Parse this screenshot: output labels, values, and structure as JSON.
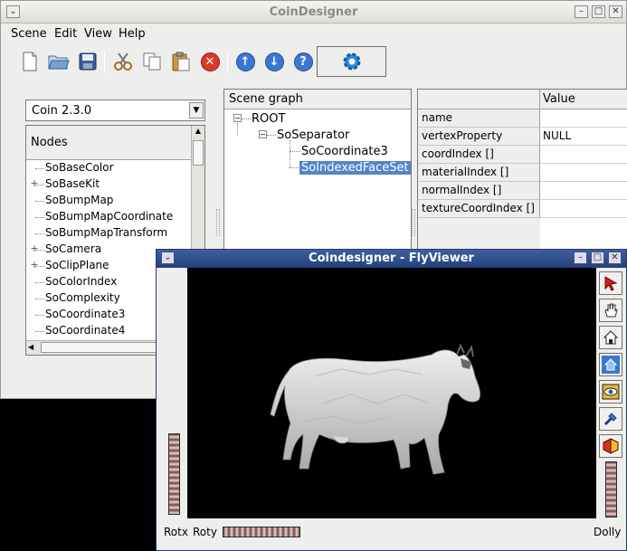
{
  "main_window": {
    "title": "CoinDesigner",
    "menu": [
      "Scene",
      "Edit",
      "View",
      "Help"
    ],
    "toolbar_icons": [
      "new-file-icon",
      "open-folder-icon",
      "save-icon",
      "cut-icon",
      "copy-icon",
      "paste-icon",
      "delete-icon",
      "up-arrow-icon",
      "down-arrow-icon",
      "help-icon",
      "gear-icon"
    ]
  },
  "node_library": {
    "combo_value": "Coin 2.3.0",
    "header": "Nodes",
    "items": [
      {
        "label": "SoBaseColor",
        "expandable": false
      },
      {
        "label": "SoBaseKit",
        "expandable": true
      },
      {
        "label": "SoBumpMap",
        "expandable": false
      },
      {
        "label": "SoBumpMapCoordinate",
        "expandable": false
      },
      {
        "label": "SoBumpMapTransform",
        "expandable": false
      },
      {
        "label": "SoCamera",
        "expandable": true
      },
      {
        "label": "SoClipPlane",
        "expandable": true
      },
      {
        "label": "SoColorIndex",
        "expandable": false
      },
      {
        "label": "SoComplexity",
        "expandable": false
      },
      {
        "label": "SoCoordinate3",
        "expandable": false
      },
      {
        "label": "SoCoordinate4",
        "expandable": false
      }
    ]
  },
  "scene_graph": {
    "header": "Scene graph",
    "root": "ROOT",
    "separator": "SoSeparator",
    "children": [
      "SoCoordinate3",
      "SoIndexedFaceSet"
    ],
    "selected": "SoIndexedFaceSet"
  },
  "properties": {
    "value_header": "Value",
    "rows": [
      {
        "name": "name",
        "value": ""
      },
      {
        "name": "vertexProperty",
        "value": "NULL"
      },
      {
        "name": "coordIndex []",
        "value": ""
      },
      {
        "name": "materialIndex []",
        "value": ""
      },
      {
        "name": "normalIndex []",
        "value": ""
      },
      {
        "name": "textureCoordIndex []",
        "value": ""
      }
    ]
  },
  "viewer": {
    "title": "Coindesigner - FlyViewer",
    "rotx_label": "Rotx",
    "roty_label": "Roty",
    "dolly_label": "Dolly",
    "side_tools": [
      "select-arrow-icon",
      "hand-icon",
      "home-icon",
      "set-home-icon",
      "view-all-icon",
      "seek-icon",
      "perspective-icon"
    ],
    "viewport_background": "#000000",
    "model_color": "#d8d8d8"
  },
  "colors": {
    "selection": "#5484c9",
    "viewer_title": "#2e4f8e"
  }
}
